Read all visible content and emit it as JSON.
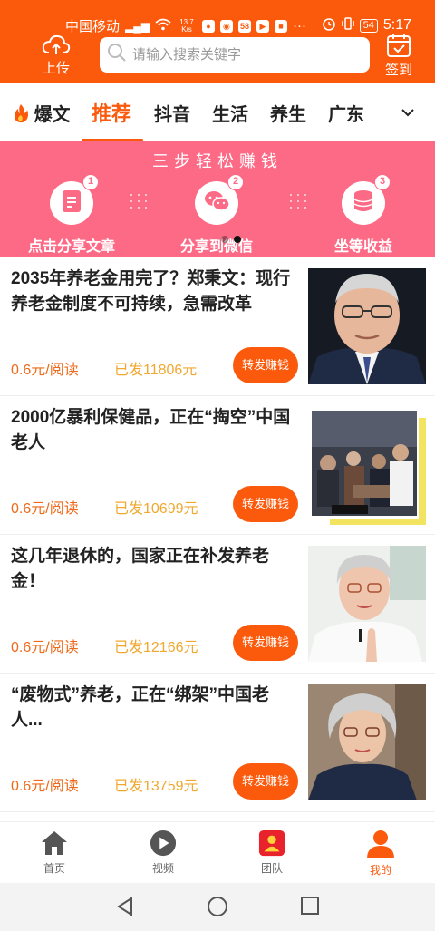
{
  "status_bar": {
    "carrier": "中国移动",
    "net_speed_value": "13.7",
    "net_speed_unit": "K/s",
    "badge_58": "58",
    "battery": "54",
    "time": "5:17"
  },
  "header": {
    "upload_label": "上传",
    "search_placeholder": "请输入搜索关键字",
    "checkin_label": "签到"
  },
  "tabs": [
    {
      "label": "爆文"
    },
    {
      "label": "推荐"
    },
    {
      "label": "抖音"
    },
    {
      "label": "生活"
    },
    {
      "label": "养生"
    },
    {
      "label": "广东"
    }
  ],
  "banner": {
    "title": "三步轻松赚钱",
    "steps": [
      {
        "num": "1",
        "label": "点击分享文章"
      },
      {
        "num": "2",
        "label": "分享到微信"
      },
      {
        "num": "3",
        "label": "坐等收益"
      }
    ]
  },
  "articles": [
    {
      "title": "2035年养老金用完了？郑秉文：现行养老金制度不可持续，急需改革",
      "price": "0.6元/阅读",
      "sent": "已发11806元",
      "button": "转发赚钱"
    },
    {
      "title": "2000亿暴利保健品，正在“掏空”中国老人",
      "price": "0.6元/阅读",
      "sent": "已发10699元",
      "button": "转发赚钱"
    },
    {
      "title": "这几年退休的，国家正在补发养老金！",
      "price": "0.6元/阅读",
      "sent": "已发12166元",
      "button": "转发赚钱"
    },
    {
      "title": "“废物式”养老，正在“绑架”中国老人...",
      "price": "0.6元/阅读",
      "sent": "已发13759元",
      "button": "转发赚钱"
    }
  ],
  "bottom_nav": [
    {
      "label": "首页",
      "icon": "home-icon"
    },
    {
      "label": "视频",
      "icon": "play-icon"
    },
    {
      "label": "团队",
      "icon": "team-icon"
    },
    {
      "label": "我的",
      "icon": "user-icon"
    }
  ],
  "colors": {
    "accent": "#fb5a0d",
    "banner": "#fc6a86",
    "price": "#ee6a1a",
    "sent": "#f0a830"
  }
}
